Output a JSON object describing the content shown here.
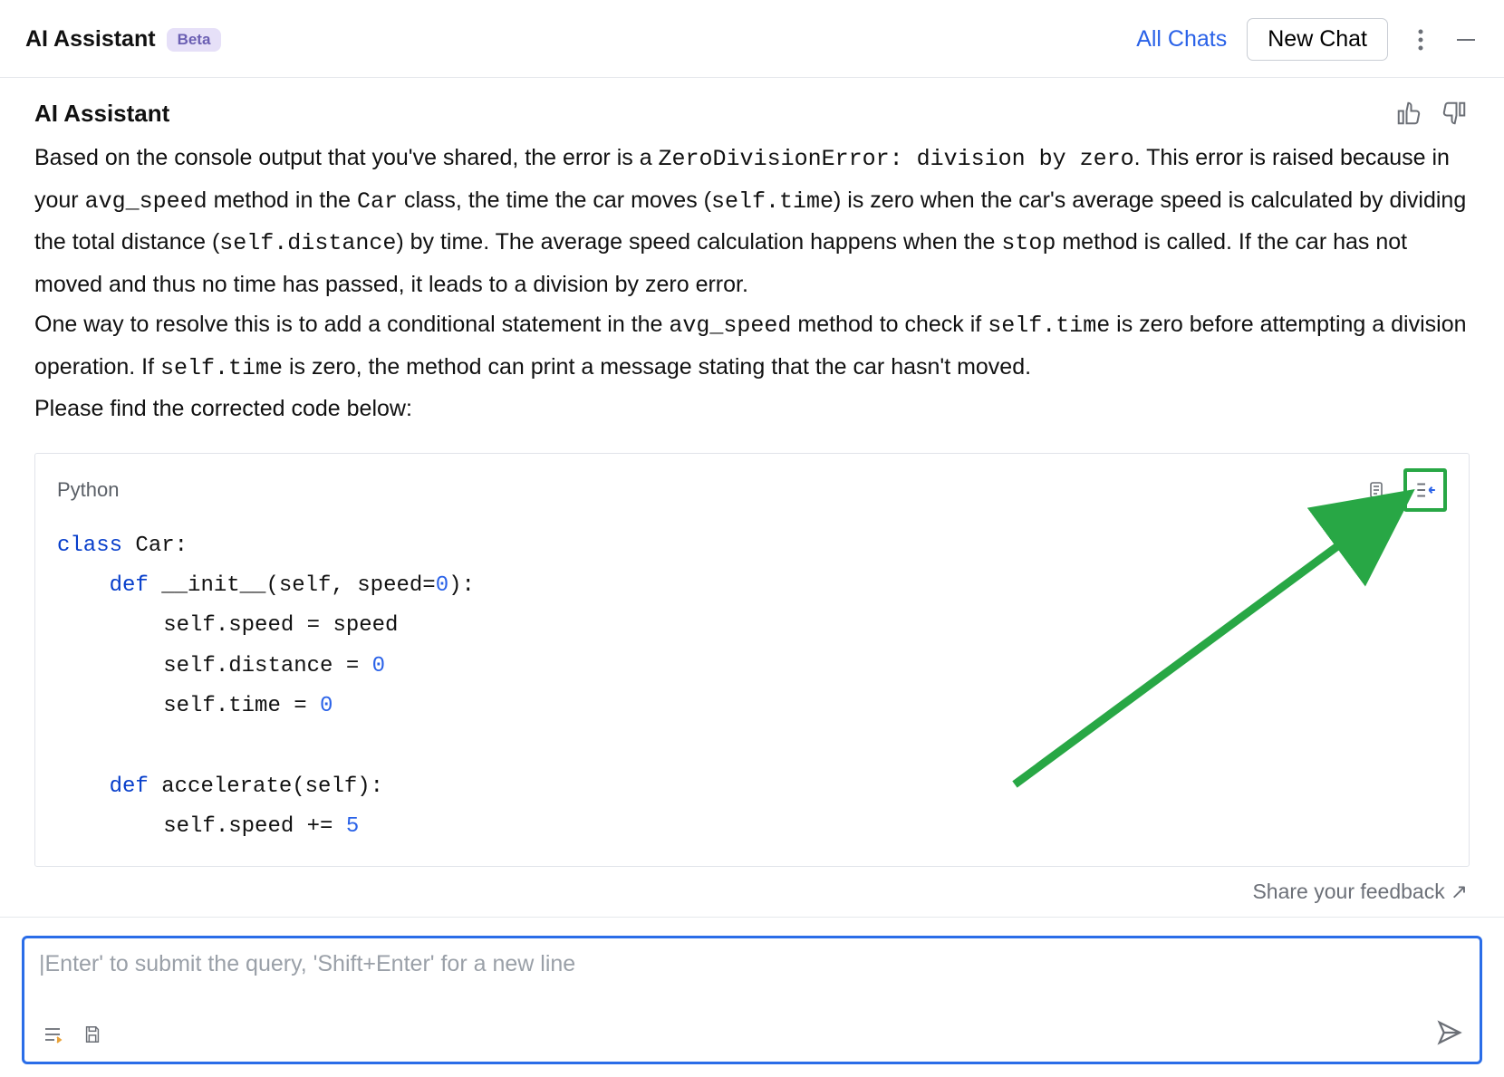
{
  "header": {
    "app_title": "AI Assistant",
    "beta_label": "Beta",
    "all_chats": "All Chats",
    "new_chat": "New Chat"
  },
  "message": {
    "sender": "AI Assistant",
    "p1_a": "Based on the console output that you've shared, the error is a ",
    "p1_code1": "ZeroDivisionError: division by zero",
    "p1_b": ". This error is raised because in your ",
    "p1_code2": "avg_speed",
    "p1_c": " method in the ",
    "p1_code3": "Car",
    "p1_d": " class, the time the car moves (",
    "p1_code4": "self.time",
    "p1_e": ") is zero when the car's average speed is calculated by dividing the total distance (",
    "p1_code5": "self.distance",
    "p1_f": ") by time. The average speed calculation happens when the ",
    "p1_code6": "stop",
    "p1_g": " method is called. If the car has not moved and thus no time has passed, it leads to a division by zero error.",
    "p2_a": "One way to resolve this is to add a conditional statement in the ",
    "p2_code1": "avg_speed",
    "p2_b": " method to check if ",
    "p2_code2": "self.time",
    "p2_c": " is zero before attempting a division operation. If ",
    "p2_code3": "self.time",
    "p2_d": " is zero, the method can print a message stating that the car hasn't moved.",
    "p3": "Please find the corrected code below:"
  },
  "code": {
    "language": "Python",
    "l1_kw": "class",
    "l1_rest": " Car:",
    "l2_kw": "def",
    "l2_rest": " __init__(self, speed=",
    "l2_num": "0",
    "l2_tail": "):",
    "l3_a": "self.speed = speed",
    "l4_a": "self.distance = ",
    "l4_num": "0",
    "l5_a": "self.time = ",
    "l5_num": "0",
    "l7_kw": "def",
    "l7_rest": " accelerate(self):",
    "l8_a": "self.speed += ",
    "l8_num": "5"
  },
  "footer": {
    "share_feedback": "Share your feedback",
    "input_placeholder": "|Enter' to submit the query, 'Shift+Enter' for a new line"
  },
  "icons": {
    "more": "more-vertical-icon",
    "minimize": "minimize-icon",
    "thumbs_up": "thumbs-up-icon",
    "thumbs_down": "thumbs-down-icon",
    "copy": "copy-icon",
    "insert": "insert-caret-icon",
    "indent": "indent-icon",
    "save": "save-icon",
    "send": "send-icon"
  }
}
